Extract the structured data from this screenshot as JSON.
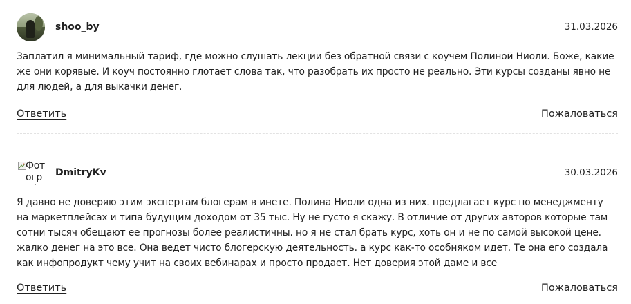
{
  "comments": [
    {
      "author": "shoo_by",
      "date": "31.03.2026",
      "text": "Заплатил я минимальный тариф, где можно слушать лекции без обратной связи с коучем Полиной Ниоли. Боже, какие же они корявые. И коуч постоянно глотает слова так, что разобрать их просто не реально. Эти курсы созданы явно не для людей, а для выкачки денег.",
      "avatar_icon": "user-photo-icon",
      "reply_label": "Ответить",
      "report_label": "Пожаловаться"
    },
    {
      "author": "DmitryKv",
      "date": "30.03.2026",
      "avatar_alt": "Фотография",
      "avatar_icon": "broken-image-icon",
      "text": "Я давно не доверяю этим экспертам блогерам в инете. Полина Ниоли одна из них. предлагает курс по менеджменту на маркетплейсах и типа будущим доходом от 35 тыс. Ну не густо я скажу. В отличие от других авторов которые там сотни тысяч обещают ее прогнозы более реалистичны. но я не стал брать курс, хоть он и не по самой высокой цене. жалко денег на это все. Она ведет чисто блогерскую деятельность. а курс как-то особняком идет. Те она его создала как инфопродукт чему учит на своих вебинарах и просто продает. Нет доверия этой даме и все",
      "reply_label": "Ответить",
      "report_label": "Пожаловаться"
    }
  ]
}
